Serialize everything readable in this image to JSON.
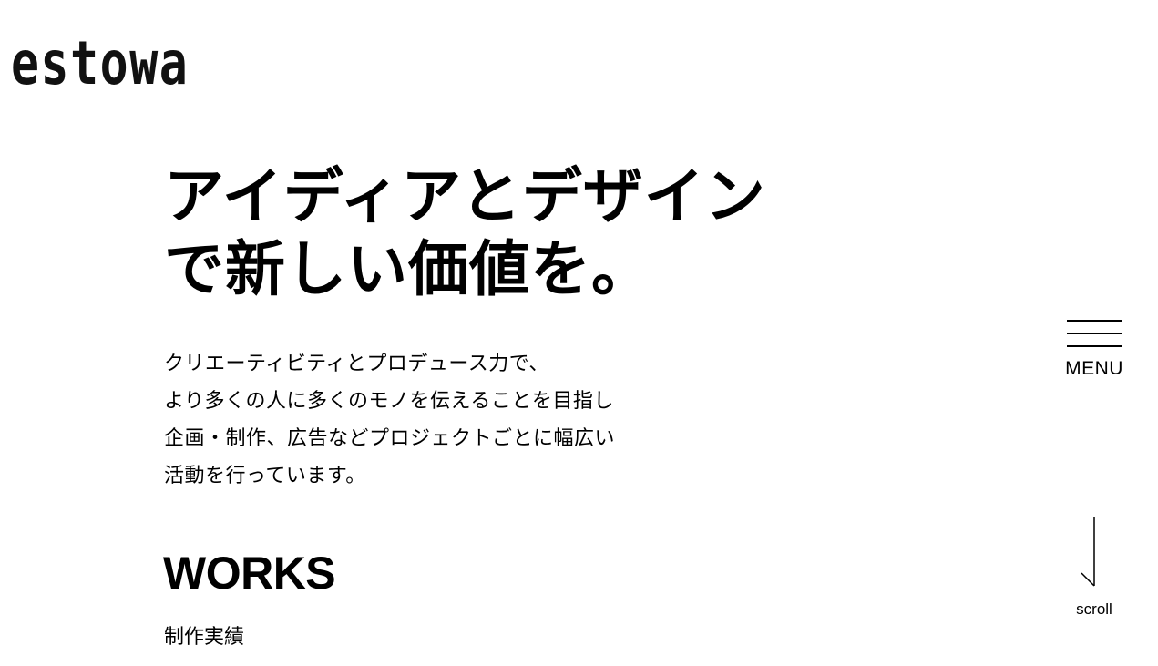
{
  "site": {
    "logo": "estowa"
  },
  "hero": {
    "title_lines": [
      "アイディアとデザイン",
      "で新しい価値を。"
    ],
    "lead_lines": [
      "クリエーティビティとプロデュース力で、",
      "より多くの人に多くのモノを伝えることを目指し",
      "企画・制作、広告などプロジェクトごとに幅広い",
      "活動を行っています。"
    ]
  },
  "works": {
    "title": "WORKS",
    "subtitle": "制作実績"
  },
  "menu": {
    "label": "MENU",
    "icon": "hamburger-icon"
  },
  "scroll": {
    "label": "scroll",
    "icon": "arrow-down-icon"
  },
  "colors": {
    "background": "#ffffff",
    "text": "#000000"
  }
}
